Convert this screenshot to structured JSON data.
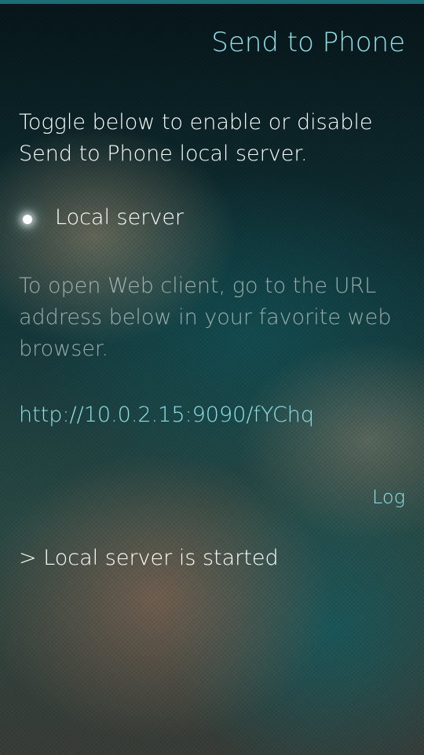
{
  "page": {
    "title": "Send to Phone"
  },
  "intro": {
    "text": "Toggle below to enable or disable Send to Phone local server."
  },
  "server_switch": {
    "label": "Local server",
    "checked": true
  },
  "hint": {
    "text": "To open Web client, go to the URL address below in your favorite web browser."
  },
  "url": {
    "text": "http://10.0.2.15:9090/fYChq"
  },
  "log": {
    "header": "Log",
    "lines": [
      "> Local server is started"
    ]
  },
  "colors": {
    "highlight": "#8fe0e8",
    "primary_text": "#ffffff",
    "secondary_text": "#cdd7d2",
    "accent_bar": "#1b6f73"
  }
}
